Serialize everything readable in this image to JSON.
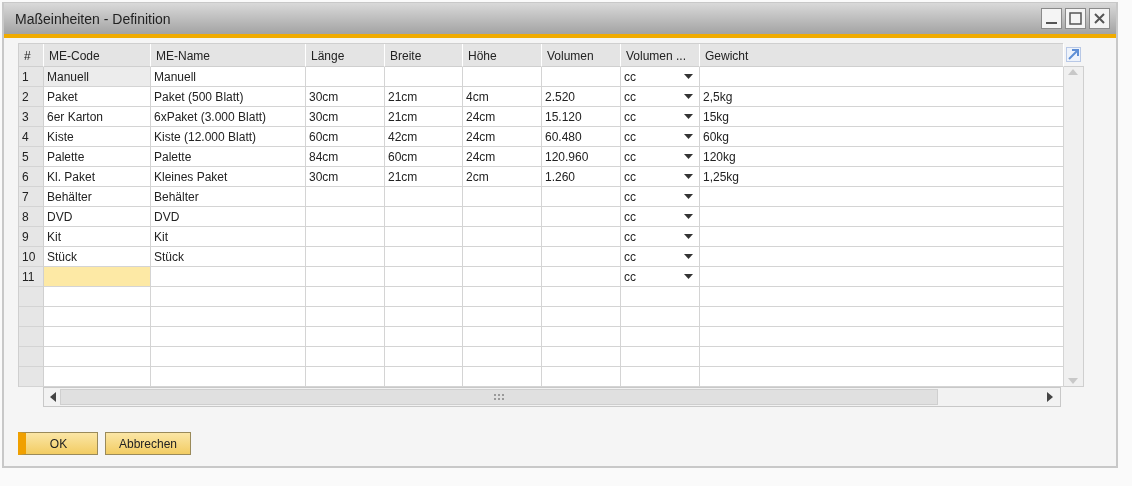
{
  "window": {
    "title": "Maßeinheiten - Definition"
  },
  "table": {
    "columns": [
      "#",
      "ME-Code",
      "ME-Name",
      "Länge",
      "Breite",
      "Höhe",
      "Volumen",
      "Volumen ...",
      "Gewicht"
    ],
    "rows": [
      {
        "number": "1",
        "code": "Manuell",
        "name": "Manuell",
        "volume_unit": "cc",
        "code_locked": true,
        "selected": false
      },
      {
        "number": "2",
        "code": "Paket",
        "name": "Paket (500 Blatt)",
        "length": "30cm",
        "width": "21cm",
        "height": "4cm",
        "volume": "2.520",
        "volume_unit": "cc",
        "weight": "2,5kg",
        "code_locked": false,
        "selected": false
      },
      {
        "number": "3",
        "code": "6er Karton",
        "name": "6xPaket (3.000 Blatt)",
        "length": "30cm",
        "width": "21cm",
        "height": "24cm",
        "volume": "15.120",
        "volume_unit": "cc",
        "weight": "15kg",
        "code_locked": false,
        "selected": false
      },
      {
        "number": "4",
        "code": "Kiste",
        "name": "Kiste (12.000 Blatt)",
        "length": "60cm",
        "width": "42cm",
        "height": "24cm",
        "volume": "60.480",
        "volume_unit": "cc",
        "weight": "60kg",
        "code_locked": false,
        "selected": false
      },
      {
        "number": "5",
        "code": "Palette",
        "name": "Palette",
        "length": "84cm",
        "width": "60cm",
        "height": "24cm",
        "volume": "120.960",
        "volume_unit": "cc",
        "weight": "120kg",
        "code_locked": false,
        "selected": false
      },
      {
        "number": "6",
        "code": "Kl. Paket",
        "name": "Kleines Paket",
        "length": "30cm",
        "width": "21cm",
        "height": "2cm",
        "volume": "1.260",
        "volume_unit": "cc",
        "weight": "1,25kg",
        "code_locked": false,
        "selected": false
      },
      {
        "number": "7",
        "code": "Behälter",
        "name": "Behälter",
        "volume_unit": "cc",
        "code_locked": false,
        "selected": false
      },
      {
        "number": "8",
        "code": "DVD",
        "name": "DVD",
        "volume_unit": "cc",
        "code_locked": false,
        "selected": false
      },
      {
        "number": "9",
        "code": "Kit",
        "name": "Kit",
        "volume_unit": "cc",
        "code_locked": false,
        "selected": false
      },
      {
        "number": "10",
        "code": "Stück",
        "name": "Stück",
        "volume_unit": "cc",
        "code_locked": false,
        "selected": false
      },
      {
        "number": "11",
        "volume_unit": "cc",
        "code_locked": false,
        "selected": true
      }
    ]
  },
  "buttons": [
    {
      "label": "OK",
      "default": true
    },
    {
      "label": "Abbrechen",
      "default": false
    }
  ]
}
